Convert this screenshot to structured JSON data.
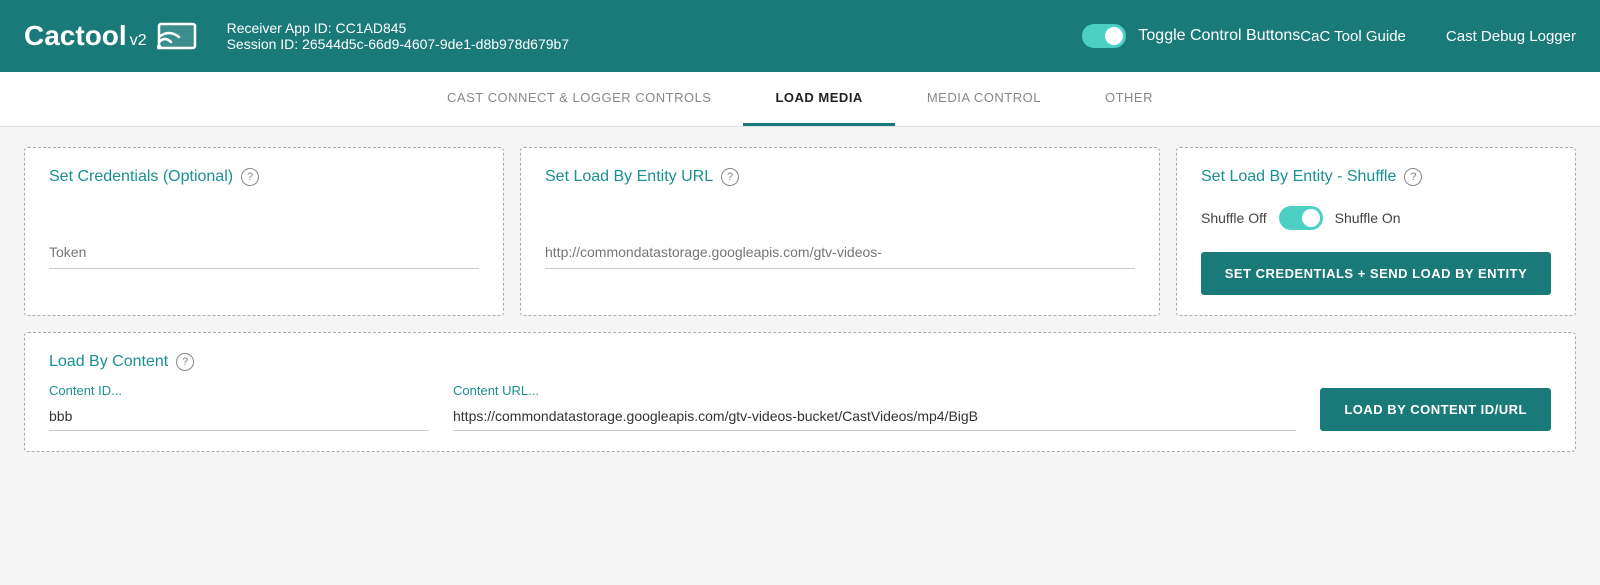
{
  "header": {
    "logo_text": "Cactool",
    "logo_version": "v2",
    "app_id_label": "Receiver App ID: CC1AD845",
    "session_id_label": "Session ID: 26544d5c-66d9-4607-9de1-d8b978d679b7",
    "toggle_label": "Toggle Control Buttons",
    "nav_link_guide": "CaC Tool Guide",
    "nav_link_logger": "Cast Debug Logger"
  },
  "tabs": [
    {
      "label": "CAST CONNECT & LOGGER CONTROLS",
      "active": false
    },
    {
      "label": "LOAD MEDIA",
      "active": true
    },
    {
      "label": "MEDIA CONTROL",
      "active": false
    },
    {
      "label": "OTHER",
      "active": false
    }
  ],
  "cards": {
    "credentials": {
      "title": "Set Credentials (Optional)",
      "token_placeholder": "Token"
    },
    "entity_url": {
      "title": "Set Load By Entity URL",
      "url_placeholder": "http://commondatastorage.googleapis.com/gtv-videos-"
    },
    "shuffle": {
      "title": "Set Load By Entity - Shuffle",
      "shuffle_off_label": "Shuffle Off",
      "shuffle_on_label": "Shuffle On",
      "button_label": "SET CREDENTIALS + SEND LOAD BY ENTITY"
    },
    "load_content": {
      "title": "Load By Content",
      "content_id_label": "Content ID...",
      "content_id_value": "bbb",
      "content_url_label": "Content URL...",
      "content_url_value": "https://commondatastorage.googleapis.com/gtv-videos-bucket/CastVideos/mp4/BigB",
      "button_label": "LOAD BY CONTENT ID/URL"
    }
  }
}
